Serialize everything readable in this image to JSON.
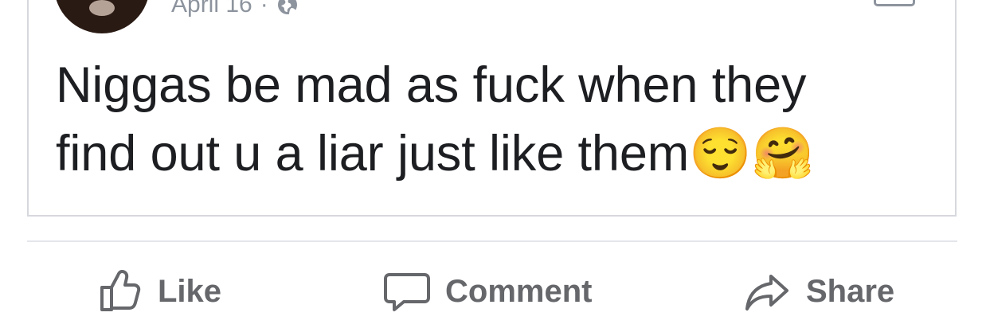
{
  "post": {
    "date": "April 16",
    "separator": "·",
    "privacy_icon": "globe-icon",
    "text": "Niggas be mad as fuck when they\nfind out u a liar just like them😌🤗"
  },
  "actions": {
    "like": {
      "label": "Like",
      "icon": "thumbs-up-icon"
    },
    "comment": {
      "label": "Comment",
      "icon": "comment-icon"
    },
    "share": {
      "label": "Share",
      "icon": "share-icon"
    }
  },
  "colors": {
    "text": "#1c1e21",
    "muted": "#65676b",
    "border": "#d6d8dd"
  }
}
